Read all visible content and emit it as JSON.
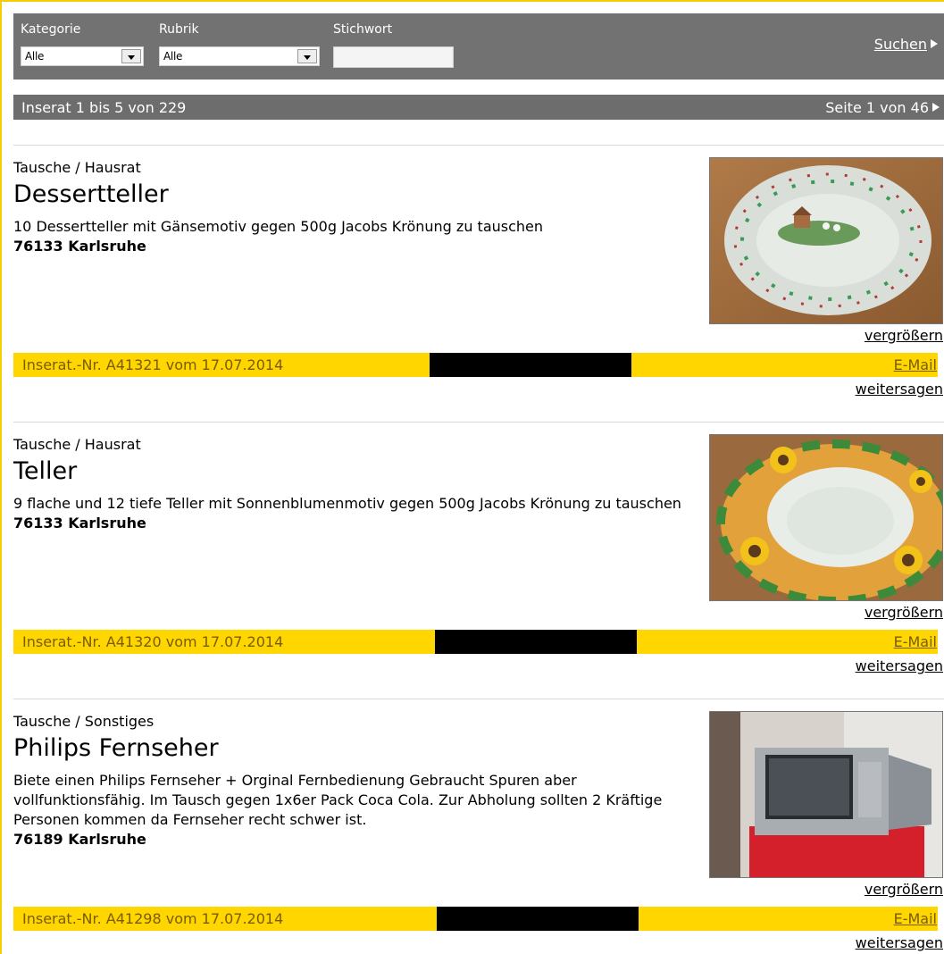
{
  "search": {
    "category_label": "Kategorie",
    "category_value": "Alle",
    "rubric_label": "Rubrik",
    "rubric_value": "Alle",
    "keyword_label": "Stichwort",
    "keyword_value": "",
    "search_label": "Suchen"
  },
  "results": {
    "summary": "Inserat 1 bis 5 von 229",
    "page": "Seite 1 von 46"
  },
  "listings": [
    {
      "category": "Tausche / Hausrat",
      "title": "Dessertteller",
      "description": "10 Dessertteller mit Gänsemotiv gegen 500g Jacobs Krönung zu tauschen",
      "location": "76133 Karlsruhe",
      "enlarge": "vergrößern",
      "ad_number": "Inserat.-Nr. A41321 vom 17.07.2014",
      "email": "E-Mail",
      "share": "weitersagen"
    },
    {
      "category": "Tausche / Hausrat",
      "title": "Teller",
      "description": "9 flache und 12 tiefe Teller mit Sonnenblumenmotiv gegen 500g Jacobs Krönung zu tauschen",
      "location": "76133 Karlsruhe",
      "enlarge": "vergrößern",
      "ad_number": "Inserat.-Nr. A41320 vom 17.07.2014",
      "email": "E-Mail",
      "share": "weitersagen"
    },
    {
      "category": "Tausche / Sonstiges",
      "title": "Philips Fernseher",
      "description": "Biete einen Philips Fernseher + Orginal Fernbedienung Gebraucht Spuren aber vollfunktionsfähig. Im Tausch gegen 1x6er Pack Coca Cola. Zur Abholung sollten 2 Kräftige Personen kommen da Fernseher recht schwer ist.",
      "location": "76189 Karlsruhe",
      "enlarge": "vergrößern",
      "ad_number": "Inserat.-Nr. A41298 vom 17.07.2014",
      "email": "E-Mail",
      "share": "weitersagen"
    }
  ],
  "colors": {
    "bar_gray": "#727272",
    "accent_yellow": "#ffd600"
  }
}
